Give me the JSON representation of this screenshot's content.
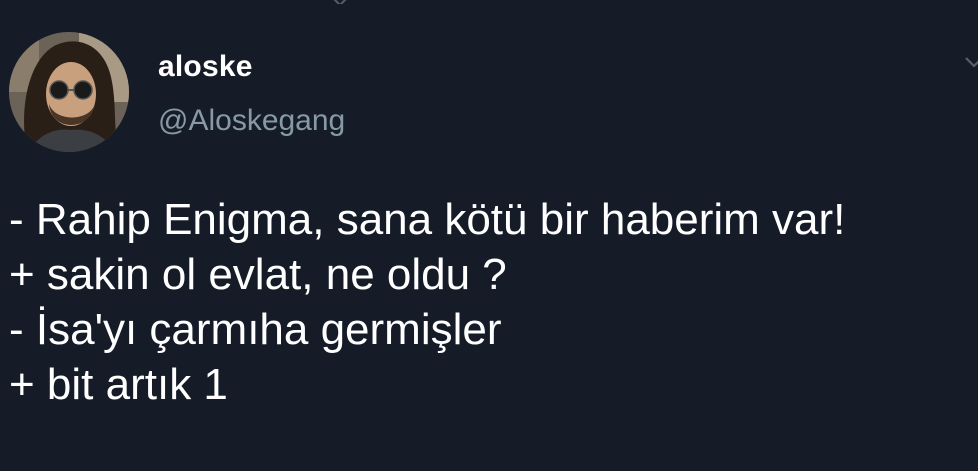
{
  "tweet": {
    "author": {
      "display_name": "aloske",
      "handle": "@Aloskegang",
      "avatar_icon": "profile-photo"
    },
    "lines": [
      "- Rahip Enigma, sana kötü bir haberim var!",
      "+ sakin ol evlat, ne oldu ?",
      "- İsa'yı çarmıha germişler",
      "+ bit artık 1"
    ],
    "menu_icon": "chevron-down-icon"
  },
  "colors": {
    "background": "#151c28",
    "text": "#ffffff",
    "secondary_text": "#8899a6"
  }
}
